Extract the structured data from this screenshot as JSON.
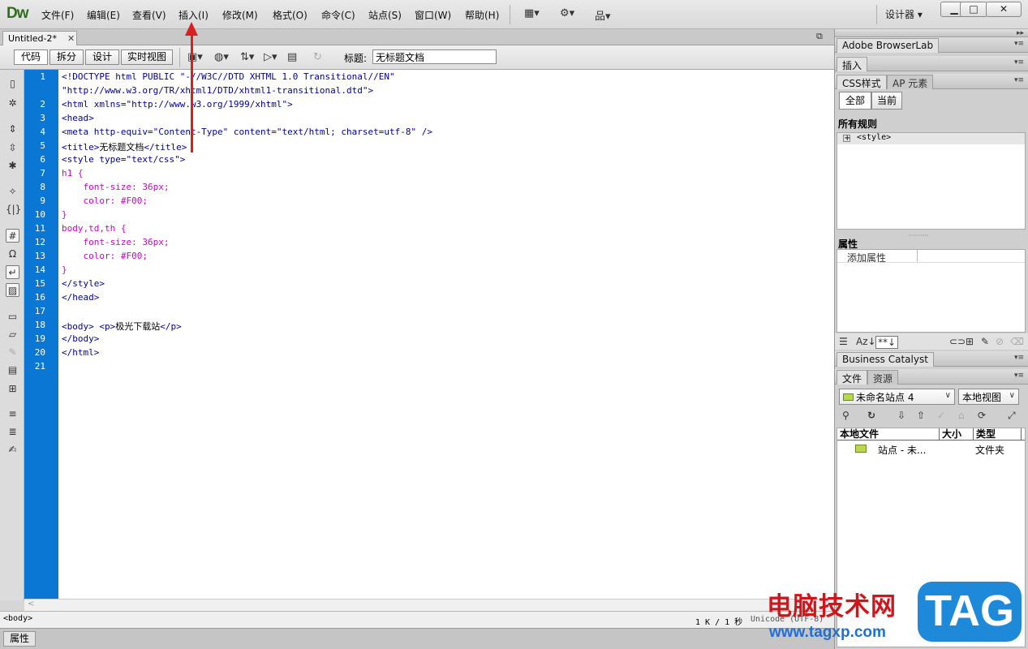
{
  "app": {
    "logo": "Dw"
  },
  "menu": [
    "文件(F)",
    "编辑(E)",
    "查看(V)",
    "插入(I)",
    "修改(M)",
    "格式(O)",
    "命令(C)",
    "站点(S)",
    "窗口(W)",
    "帮助(H)"
  ],
  "workspace": {
    "label": "设计器",
    "caret": "▾"
  },
  "window_buttons": {
    "minimize": "▁",
    "maximize": "□",
    "close": "✕"
  },
  "document": {
    "tab": "Untitled-2*",
    "tab_close": "✕",
    "title_label": "标题:",
    "title_value": "无标题文档"
  },
  "view_buttons": [
    "代码",
    "拆分",
    "设计",
    "实时视图"
  ],
  "code_lines": [
    {
      "num": "1",
      "parts": [
        [
          "tag",
          "<!DOCTYPE html PUBLIC \"-//W3C//DTD XHTML 1.0 Transitional//EN\""
        ]
      ]
    },
    {
      "num": "",
      "parts": [
        [
          "tag",
          "\"http://www.w3.org/TR/xhtml1/DTD/xhtml1-transitional.dtd\">"
        ]
      ]
    },
    {
      "num": "2",
      "parts": [
        [
          "tag",
          "<html xmlns=\"http://www.w3.org/1999/xhtml\">"
        ]
      ]
    },
    {
      "num": "3",
      "parts": [
        [
          "tag",
          "<head>"
        ]
      ]
    },
    {
      "num": "4",
      "parts": [
        [
          "tag",
          "<meta http-equiv=\"Content-Type\" content=\"text/html; charset=utf-8\" />"
        ]
      ]
    },
    {
      "num": "5",
      "parts": [
        [
          "tag",
          "<title>"
        ],
        [
          "txt",
          "无标题文档"
        ],
        [
          "tag",
          "</title>"
        ]
      ]
    },
    {
      "num": "6",
      "parts": [
        [
          "tag",
          "<style type=\"text/css\">"
        ]
      ]
    },
    {
      "num": "7",
      "parts": [
        [
          "css",
          "h1 {"
        ]
      ]
    },
    {
      "num": "8",
      "parts": [
        [
          "css",
          "    font-size: 36px;"
        ]
      ]
    },
    {
      "num": "9",
      "parts": [
        [
          "css",
          "    color: #F00;"
        ]
      ]
    },
    {
      "num": "10",
      "parts": [
        [
          "css",
          "}"
        ]
      ]
    },
    {
      "num": "11",
      "parts": [
        [
          "css",
          "body,td,th {"
        ]
      ]
    },
    {
      "num": "12",
      "parts": [
        [
          "css",
          "    font-size: 36px;"
        ]
      ]
    },
    {
      "num": "13",
      "parts": [
        [
          "css",
          "    color: #F00;"
        ]
      ]
    },
    {
      "num": "14",
      "parts": [
        [
          "css",
          "}"
        ]
      ]
    },
    {
      "num": "15",
      "parts": [
        [
          "tag",
          "</style>"
        ]
      ]
    },
    {
      "num": "16",
      "parts": [
        [
          "tag",
          "</head>"
        ]
      ]
    },
    {
      "num": "17",
      "parts": []
    },
    {
      "num": "18",
      "parts": [
        [
          "tag",
          "<body> <p>"
        ],
        [
          "txt",
          "极光下载站"
        ],
        [
          "tag",
          "</p>"
        ]
      ]
    },
    {
      "num": "19",
      "parts": [
        [
          "tag",
          "</body>"
        ]
      ]
    },
    {
      "num": "20",
      "parts": [
        [
          "tag",
          "</html>"
        ]
      ]
    },
    {
      "num": "21",
      "parts": []
    }
  ],
  "status": {
    "tag_selector": "<body>",
    "size": "1 K / 1 秒",
    "encoding": "Unicode (UTF-8)"
  },
  "properties_tab": "属性",
  "panels": {
    "browserlab": "Adobe BrowserLab",
    "insert": "插入",
    "css_tab": "CSS样式",
    "ap_tab": "AP 元素",
    "all_btn": "全部",
    "current_btn": "当前",
    "all_rules": "所有规则",
    "rule_expand": "+",
    "rule_item": "<style>",
    "properties_title": "属性",
    "add_property": "添加属性",
    "business_catalyst": "Business Catalyst",
    "files_tab": "文件",
    "assets_tab": "资源",
    "site_select": "未命名站点 4",
    "view_select": "本地视图",
    "col_local": "本地文件",
    "col_size": "大小",
    "col_type": "类型",
    "file_name": "站点 - 未...",
    "file_type": "文件夹"
  },
  "watermark": {
    "text": "电脑技术网",
    "url": "www.tagxp.com",
    "badge": "TAG"
  },
  "colors": {
    "gutter": "#0a77d4",
    "tag": "#000099",
    "css": "#cc00cc",
    "annotation_arrow": "#d92020",
    "watermark_red": "#d0161b",
    "watermark_blue": "#1e88d9"
  }
}
